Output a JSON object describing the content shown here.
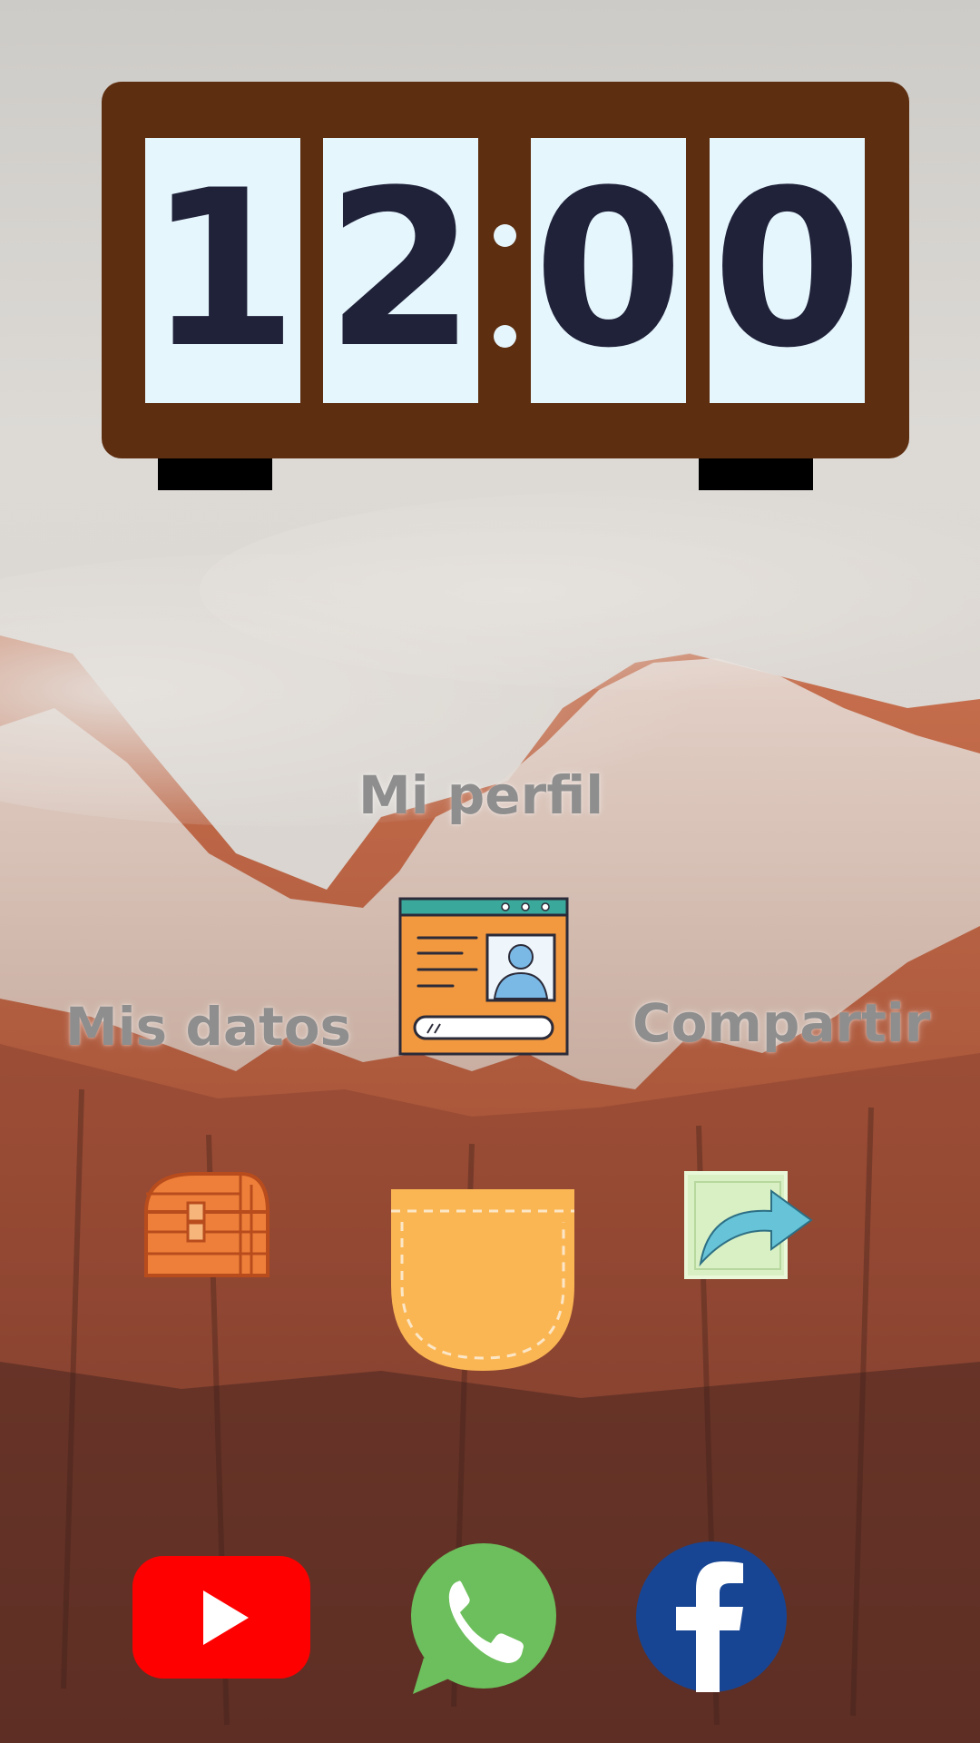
{
  "clock": {
    "digits": [
      "1",
      "2",
      "0",
      "0"
    ]
  },
  "shortcuts": {
    "profile": {
      "label": "Mi perfil",
      "icon": "profile-card-icon"
    },
    "my_data": {
      "label": "Mis datos",
      "icon": "treasure-chest-icon"
    },
    "share": {
      "label": "Compartir",
      "icon": "share-arrow-icon"
    },
    "pocket": {
      "icon": "pocket-icon"
    }
  },
  "dock": [
    {
      "icon": "youtube-icon",
      "color": "#ff0000"
    },
    {
      "icon": "whatsapp-icon",
      "color": "#6cbf5c"
    },
    {
      "icon": "facebook-icon",
      "color": "#174594"
    }
  ],
  "colors": {
    "clock_frame": "#5e2e10",
    "clock_face": "#e6f6fd",
    "digit": "#20223a"
  }
}
